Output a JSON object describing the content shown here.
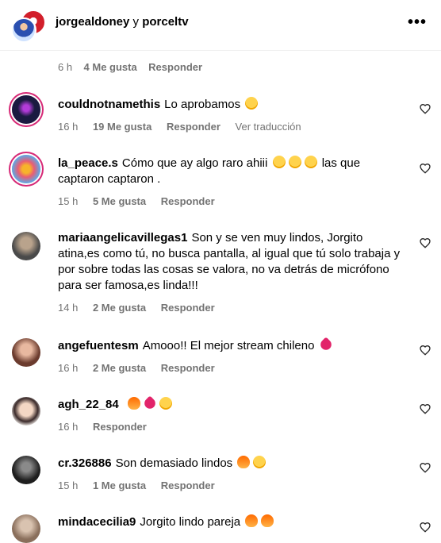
{
  "header": {
    "user1": "jorgealdoney",
    "connector": "y",
    "user2": "porceltv",
    "more_label": "•••"
  },
  "previous": {
    "time": "6 h",
    "likes": "4 Me gusta",
    "reply": "Responder"
  },
  "comments": [
    {
      "user": "couldnotnamethis",
      "text": "Lo aprobamos",
      "emoji": [
        "smile"
      ],
      "time": "16 h",
      "likes": "19 Me gusta",
      "reply": "Responder",
      "translate": "Ver traducción"
    },
    {
      "user": "la_peace.s",
      "text": "Cómo que ay algo raro ahiii",
      "text2": "las que captaron captaron .",
      "emoji": [
        "smile",
        "eyes",
        "eyes"
      ],
      "time": "15 h",
      "likes": "5 Me gusta",
      "reply": "Responder"
    },
    {
      "user": "mariaangelicavillegas1",
      "text": "Son y se ven muy lindos, Jorgito atina,es como tú, no busca pantalla, al igual que tú solo trabaja y por sobre todas las cosas se valora, no va detrás de micrófono para ser famosa,es linda!!!",
      "time": "14 h",
      "likes": "2 Me gusta",
      "reply": "Responder"
    },
    {
      "user": "angefuentesm",
      "text": "Amooo!! El mejor stream chileno",
      "emoji": [
        "pink"
      ],
      "time": "16 h",
      "likes": "2 Me gusta",
      "reply": "Responder"
    },
    {
      "user": "agh_22_84",
      "text": "",
      "emoji": [
        "fire",
        "pink",
        "eyes"
      ],
      "time": "16 h",
      "reply": "Responder"
    },
    {
      "user": "cr.326886",
      "text": "Son demasiado lindos",
      "emoji": [
        "fire",
        "eyes"
      ],
      "time": "15 h",
      "likes": "1 Me gusta",
      "reply": "Responder"
    },
    {
      "user": "mindacecilia9",
      "text": "Jorgito lindo pareja",
      "emoji": [
        "fire",
        "fire"
      ]
    }
  ],
  "colors": {
    "meta_text": "#737373",
    "story_ring": "#d62976",
    "reaction_heart": "#e2246a"
  },
  "icons": {
    "like": "heart-outline-icon",
    "more": "more-horizontal-icon"
  }
}
